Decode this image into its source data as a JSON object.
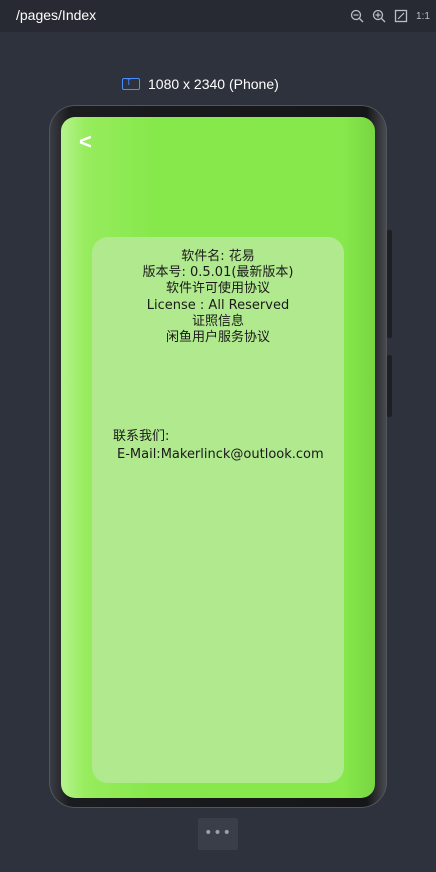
{
  "toolbar": {
    "route": "/pages/Index",
    "zoom_out_icon": "zoom-out-icon",
    "zoom_in_icon": "zoom-in-icon",
    "fit_icon": "fit-screen-icon",
    "actual_size_label": "1:1"
  },
  "device": {
    "label": "1080 x 2340 (Phone)"
  },
  "app": {
    "back_label": "<",
    "info_lines": [
      "软件名: 花易",
      "版本号: 0.5.01(最新版本)",
      "软件许可使用协议",
      "License : All Reserved",
      "证照信息",
      "闲鱼用户服务协议"
    ],
    "contact_title": "联系我们:",
    "contact_email": "E-Mail:Makerlinck@outlook.com"
  },
  "footer": {
    "more_label": "•••"
  },
  "colors": {
    "background": "#2e323c",
    "screen_green": "#86e84b",
    "card_green": "#b0e98e"
  }
}
